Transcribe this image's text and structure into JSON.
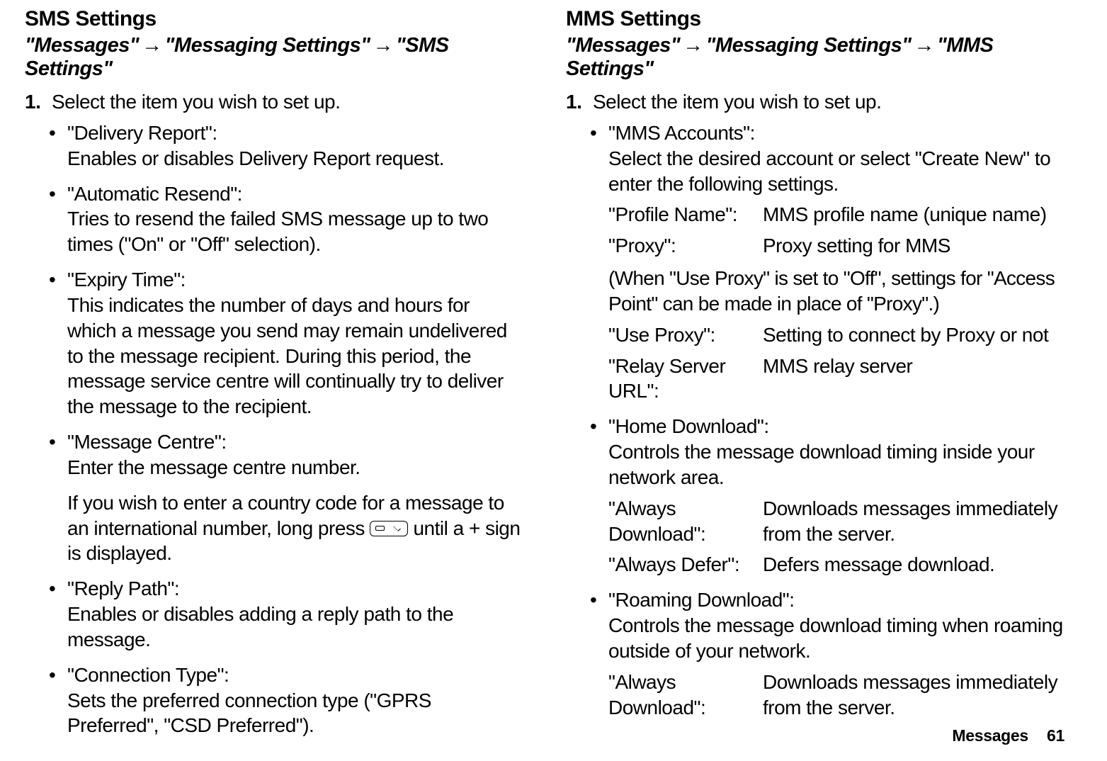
{
  "left": {
    "title": "SMS Settings",
    "crumb1": "\"Messages\"",
    "crumb2": "\"Messaging Settings\"",
    "crumb3": "\"SMS Settings\"",
    "step_num": "1.",
    "step_text": "Select the item you wish to set up.",
    "bullets": [
      {
        "title": "\"Delivery Report\":",
        "desc": "Enables or disables Delivery Report request."
      },
      {
        "title": "\"Automatic Resend\":",
        "desc": "Tries to resend the failed SMS message up to two times (\"On\" or \"Off\" selection)."
      },
      {
        "title": "\"Expiry Time\":",
        "desc": "This indicates the number of days and hours for which a message you send may remain undelivered to the message recipient. During this period, the message service centre will continually try to deliver the message to the recipient."
      },
      {
        "title": "\"Message Centre\":",
        "desc": "Enter the message centre number.",
        "extra_pre": "If you wish to enter a country code for a message to an international number, long press ",
        "extra_post": " until a + sign is displayed."
      },
      {
        "title": "\"Reply Path\":",
        "desc": "Enables or disables adding a reply path to the message."
      },
      {
        "title": "\"Connection Type\":",
        "desc": "Sets the preferred connection type (\"GPRS Preferred\", \"CSD Preferred\")."
      }
    ]
  },
  "right": {
    "title": "MMS Settings",
    "crumb1": "\"Messages\"",
    "crumb2": "\"Messaging Settings\"",
    "crumb3": "\"MMS Settings\"",
    "step_num": "1.",
    "step_text": "Select the item you wish to set up.",
    "bullets": {
      "b0": {
        "title": "\"MMS Accounts\":",
        "desc": "Select the desired account or select \"Create New\" to enter the following settings.",
        "defs": [
          {
            "label": "\"Profile Name\":",
            "value": "MMS profile name (unique name)"
          },
          {
            "label": "\"Proxy\":",
            "value": "Proxy setting for MMS"
          }
        ],
        "note": "(When \"Use Proxy\" is set to \"Off\", settings for \"Access Point\" can be made in place of \"Proxy\".)",
        "defs2": [
          {
            "label": "\"Use Proxy\":",
            "value": "Setting to connect by Proxy or not"
          },
          {
            "label": "\"Relay Server URL\":",
            "value": "MMS relay server"
          }
        ]
      },
      "b1": {
        "title": "\"Home Download\":",
        "desc": "Controls the message download timing inside your network area.",
        "defs": [
          {
            "label": "\"Always Download\":",
            "value": "Downloads messages immediately from the server."
          },
          {
            "label": "\"Always Defer\":",
            "value": "Defers message download."
          }
        ]
      },
      "b2": {
        "title": "\"Roaming Download\":",
        "desc": "Controls the message download timing when roaming outside of your network.",
        "defs": [
          {
            "label": "\"Always Download\":",
            "value": "Downloads messages immediately from the server."
          }
        ]
      }
    }
  },
  "footer": {
    "section": "Messages",
    "page": "61"
  },
  "arrow": "→"
}
